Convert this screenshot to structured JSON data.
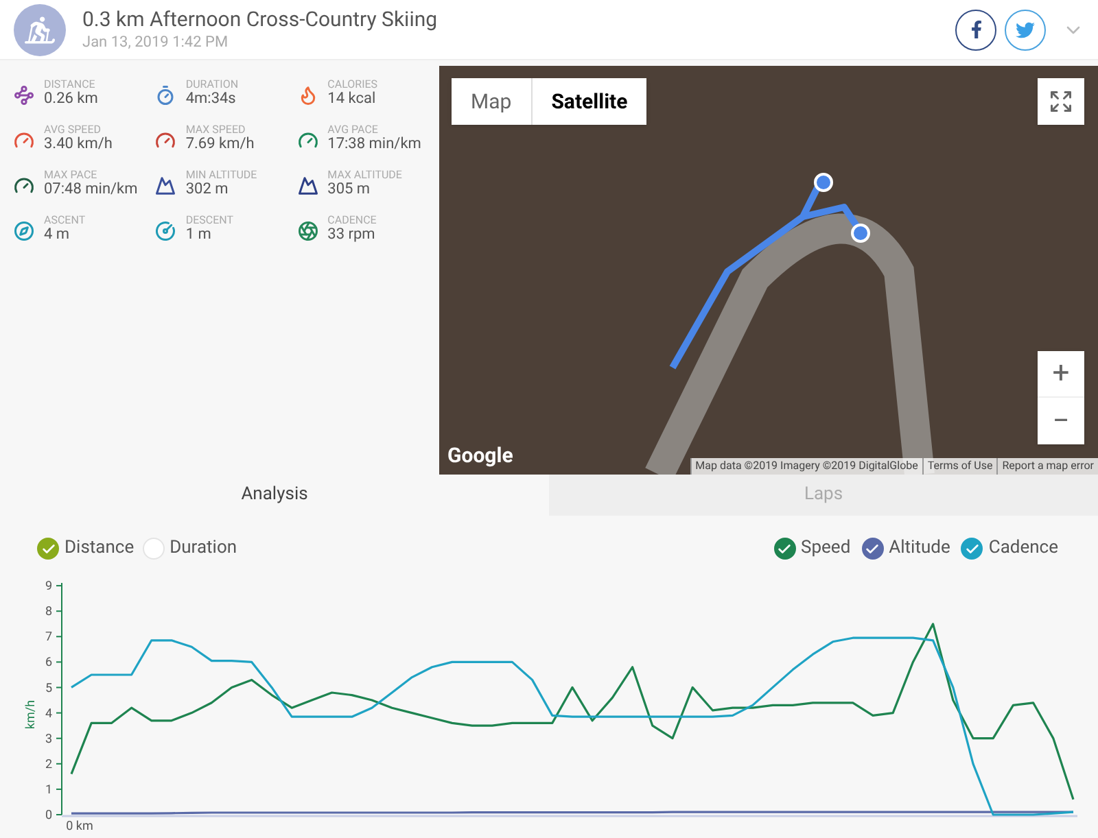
{
  "header": {
    "title": "0.3 km Afternoon Cross-Country Skiing",
    "date": "Jan 13, 2019 1:42 PM"
  },
  "stats": [
    {
      "label": "DISTANCE",
      "value": "0.26 km"
    },
    {
      "label": "DURATION",
      "value": "4m:34s"
    },
    {
      "label": "CALORIES",
      "value": "14 kcal"
    },
    {
      "label": "AVG SPEED",
      "value": "3.40 km/h"
    },
    {
      "label": "MAX SPEED",
      "value": "7.69 km/h"
    },
    {
      "label": "AVG PACE",
      "value": "17:38 min/km"
    },
    {
      "label": "MAX PACE",
      "value": "07:48 min/km"
    },
    {
      "label": "MIN ALTITUDE",
      "value": "302 m"
    },
    {
      "label": "MAX ALTITUDE",
      "value": "305 m"
    },
    {
      "label": "ASCENT",
      "value": "4 m"
    },
    {
      "label": "DESCENT",
      "value": "1 m"
    },
    {
      "label": "CADENCE",
      "value": "33 rpm"
    }
  ],
  "map": {
    "type_buttons": [
      {
        "label": "Map",
        "selected": false
      },
      {
        "label": "Satellite",
        "selected": true
      }
    ],
    "zoom_in": "+",
    "zoom_out": "−",
    "logo": "Google",
    "attribution": [
      "Map data ©2019 Imagery ©2019 DigitalGlobe",
      "Terms of Use",
      "Report a map error"
    ]
  },
  "tabs": [
    {
      "label": "Analysis",
      "selected": true
    },
    {
      "label": "Laps",
      "selected": false
    }
  ],
  "x_toggles": [
    {
      "label": "Distance",
      "checked": true,
      "color": "#8aab1c"
    },
    {
      "label": "Duration",
      "checked": false
    }
  ],
  "series_toggles": [
    {
      "checked": true
    },
    {
      "checked": true
    },
    {
      "checked": true
    }
  ],
  "x_axis_start_label": "0 km",
  "chart_data": {
    "type": "line",
    "ylabel": "km/h",
    "ylim": [
      0,
      9
    ],
    "yticks": [
      0,
      1,
      2,
      3,
      4,
      5,
      6,
      7,
      8,
      9
    ],
    "series": [
      {
        "name": "Speed",
        "color": "#1e8450",
        "values": [
          1.6,
          3.6,
          3.6,
          4.2,
          3.7,
          3.7,
          4.0,
          4.4,
          5.0,
          5.3,
          4.7,
          4.2,
          4.5,
          4.8,
          4.7,
          4.5,
          4.2,
          4.0,
          3.8,
          3.6,
          3.5,
          3.5,
          3.6,
          3.6,
          3.6,
          5.0,
          3.7,
          4.6,
          5.8,
          3.5,
          3.0,
          5.0,
          4.1,
          4.2,
          4.2,
          4.3,
          4.3,
          4.4,
          4.4,
          4.4,
          3.9,
          4.0,
          6.0,
          7.5,
          4.5,
          3.0,
          3.0,
          4.3,
          4.4,
          3.0,
          0.6
        ]
      },
      {
        "name": "Altitude",
        "color": "#5a6aa8",
        "values": [
          0.05,
          0.05,
          0.05,
          0.05,
          0.05,
          0.06,
          0.07,
          0.08,
          0.08,
          0.08,
          0.08,
          0.08,
          0.08,
          0.08,
          0.08,
          0.08,
          0.08,
          0.08,
          0.08,
          0.08,
          0.09,
          0.09,
          0.09,
          0.09,
          0.09,
          0.09,
          0.09,
          0.09,
          0.09,
          0.09,
          0.1,
          0.1,
          0.1,
          0.1,
          0.1,
          0.1,
          0.1,
          0.1,
          0.1,
          0.1,
          0.1,
          0.1,
          0.1,
          0.1,
          0.1,
          0.1,
          0.1,
          0.1,
          0.1,
          0.1,
          0.1
        ]
      },
      {
        "name": "Cadence",
        "color": "#1fa3c4",
        "values": [
          5.0,
          5.5,
          5.5,
          5.5,
          6.85,
          6.85,
          6.6,
          6.05,
          6.05,
          6.0,
          5.0,
          3.85,
          3.85,
          3.85,
          3.85,
          4.2,
          4.8,
          5.4,
          5.8,
          6.0,
          6.0,
          6.0,
          6.0,
          5.3,
          3.9,
          3.85,
          3.85,
          3.85,
          3.85,
          3.85,
          3.85,
          3.85,
          3.85,
          3.9,
          4.3,
          5.0,
          5.7,
          6.3,
          6.8,
          6.95,
          6.95,
          6.95,
          6.95,
          6.85,
          5.0,
          2.0,
          0,
          0,
          0,
          0.05,
          0.1
        ]
      }
    ]
  }
}
